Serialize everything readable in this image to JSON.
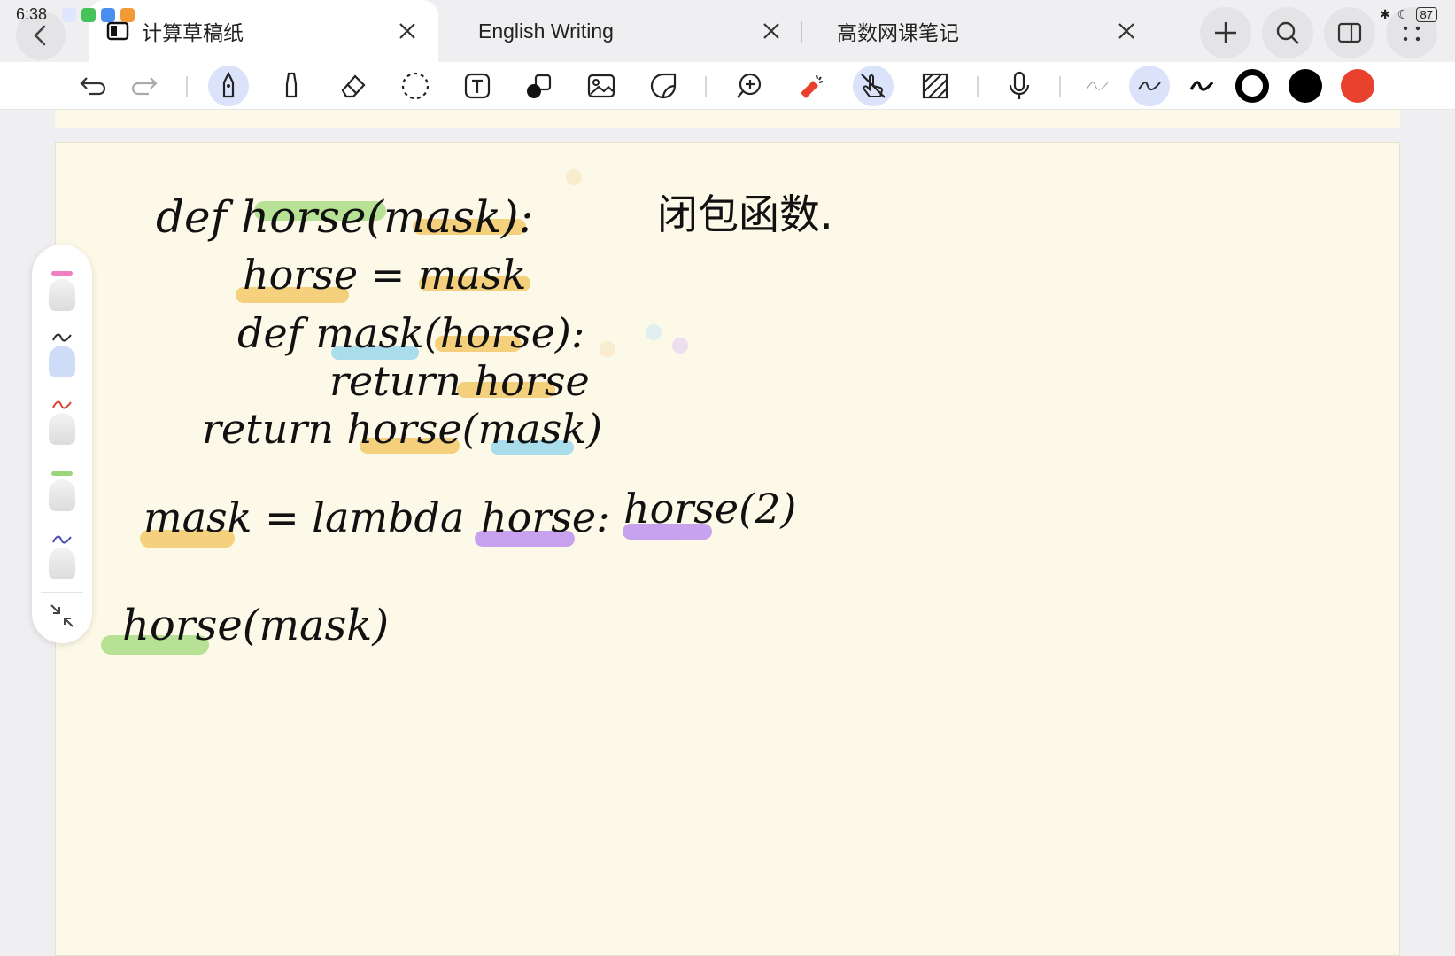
{
  "status": {
    "time": "6:38",
    "battery": "87"
  },
  "tabs": [
    {
      "label": "计算草稿纸",
      "active": true
    },
    {
      "label": "English Writing",
      "active": false
    },
    {
      "label": "高数网课笔记",
      "active": false
    }
  ],
  "toolbar": {
    "tools": [
      "undo-icon",
      "redo-icon",
      "pen-icon",
      "highlighter-icon",
      "eraser-icon",
      "lasso-icon",
      "text-box-icon",
      "shapes-icon",
      "image-icon",
      "sticker-icon",
      "zoom-in-icon",
      "laser-pointer-icon",
      "hand-touch-icon",
      "pattern-icon",
      "microphone-icon"
    ],
    "strokes": [
      "thin",
      "medium",
      "thick"
    ],
    "colors": [
      "#000000",
      "#000000",
      "#e8412e"
    ]
  },
  "pens": [
    {
      "color": "#ef7fbf",
      "kind": "highlighter"
    },
    {
      "color": "#2a2a2a",
      "kind": "pen"
    },
    {
      "color": "#d9473a",
      "kind": "pen"
    },
    {
      "color": "#9cd67a",
      "kind": "highlighter"
    },
    {
      "color": "#4a4fb0",
      "kind": "pen"
    }
  ],
  "handwriting": {
    "line1": "def horse(mask):",
    "note_cn": "闭包函数.",
    "line2": "horse = mask",
    "line3": "def mask(horse):",
    "line4": "return horse",
    "line5": "return horse(mask)",
    "line6a": "mask = lambda",
    "line6b": "horse:",
    "line6c": "horse(2)",
    "line7": "horse(mask)"
  },
  "highlight_colors": {
    "green": "#9fd97a",
    "orange": "#f2c35a",
    "blue": "#8fd4ee",
    "purple": "#b784f0"
  }
}
